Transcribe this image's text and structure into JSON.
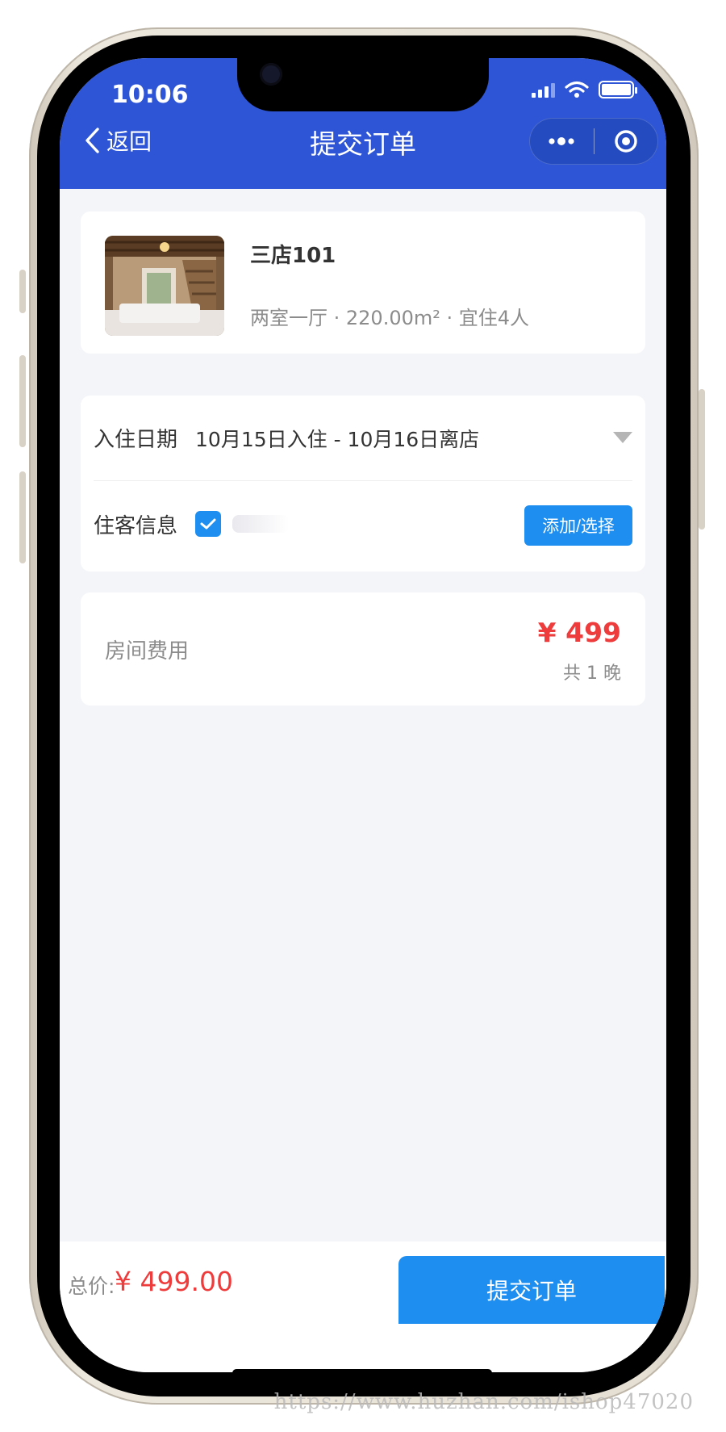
{
  "status_bar": {
    "time": "10:06"
  },
  "nav": {
    "back_label": "返回",
    "title": "提交订单"
  },
  "room": {
    "name": "三店101",
    "meta": "两室一厅 · 220.00m² · 宜住4人"
  },
  "stay": {
    "label": "入住日期",
    "value": "10月15日入住 - 10月16日离店"
  },
  "guest": {
    "label": "住客信息",
    "checked": true,
    "button_label": "添加/选择"
  },
  "fee": {
    "label": "房间费用",
    "price": "¥ 499",
    "nights": "共 1 晚"
  },
  "footer": {
    "total_label": "总价:",
    "total_value": "¥ 499.00",
    "submit_label": "提交订单"
  },
  "watermark": {
    "bottom": "https://www.huzhan.com/ishop47020"
  },
  "colors": {
    "header": "#2d55d6",
    "button": "#1e8ff0",
    "price": "#ee3b3b",
    "background": "#f4f5f8"
  }
}
